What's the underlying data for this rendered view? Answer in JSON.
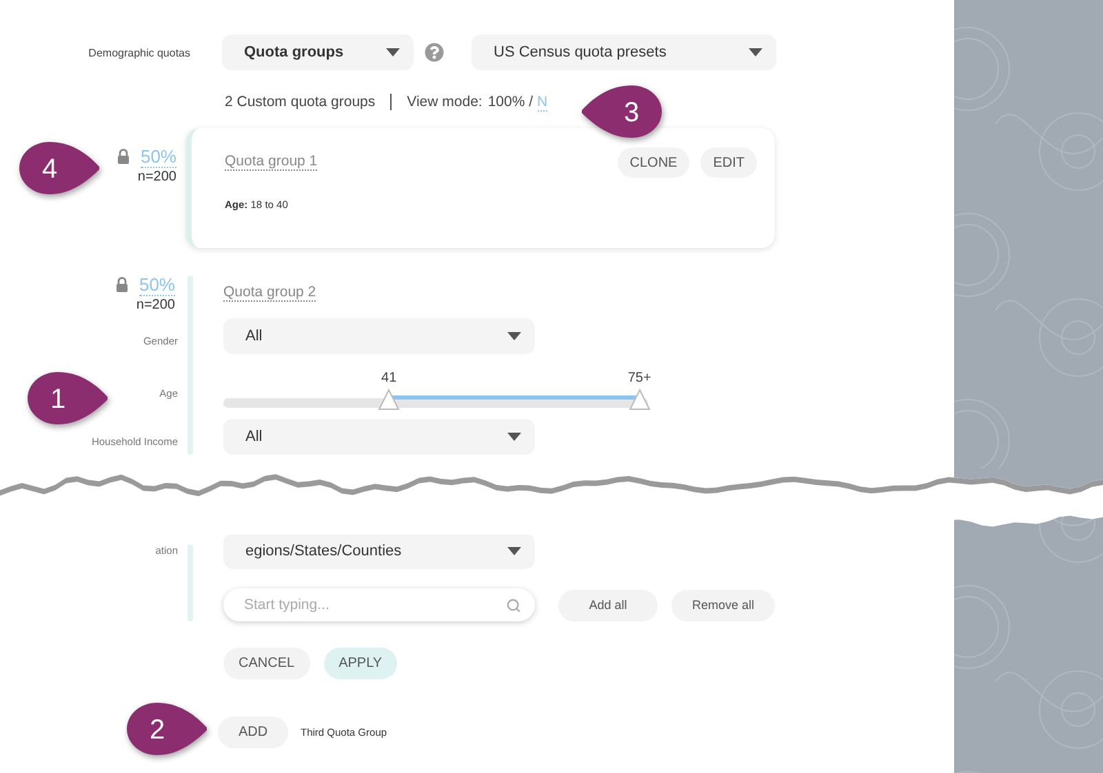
{
  "filter_row": {
    "label": "Demographic quotas",
    "group_select": "Quota groups",
    "preset_select": "US Census quota presets"
  },
  "summary": {
    "count": "2 Custom quota groups",
    "view_mode_label": "View mode:",
    "view_mode_value": "100% /",
    "view_mode_link": "N"
  },
  "quota_groups": [
    {
      "kind": "summary",
      "locked": true,
      "share": "50%",
      "count": "n=200",
      "title": "Quota group 1",
      "criteria_label": "Age:",
      "criteria_value": "18 to 40",
      "buttons": [
        "CLONE",
        "EDIT"
      ]
    },
    {
      "kind": "editor",
      "locked": true,
      "share": "50%",
      "count": "n=200",
      "title": "Quota group 2",
      "fields": [
        {
          "kind": "select",
          "label": "Gender",
          "value": "All"
        },
        {
          "kind": "range",
          "label": "Age",
          "thumbs": [
            {
              "label": "41",
              "level": 0.39
            },
            {
              "label": "75+",
              "level": 0.98
            }
          ]
        },
        {
          "kind": "select",
          "label": "Household Income",
          "value": "All"
        }
      ]
    }
  ],
  "continued": {
    "fields": [
      {
        "kind": "select",
        "label": "ation",
        "value": "egions/States/Counties"
      },
      {
        "kind": "search",
        "placeholder": "Start typing...",
        "buttons": [
          "Add all",
          "Remove all"
        ]
      }
    ],
    "actions": [
      {
        "label": "CANCEL",
        "primary": false
      },
      {
        "label": "APPLY",
        "primary": true
      }
    ]
  },
  "add": {
    "button": "ADD",
    "caption": "Third Quota Group"
  },
  "callouts": [
    {
      "number": "3"
    },
    {
      "number": "4"
    },
    {
      "number": "1"
    },
    {
      "number": "2"
    }
  ]
}
